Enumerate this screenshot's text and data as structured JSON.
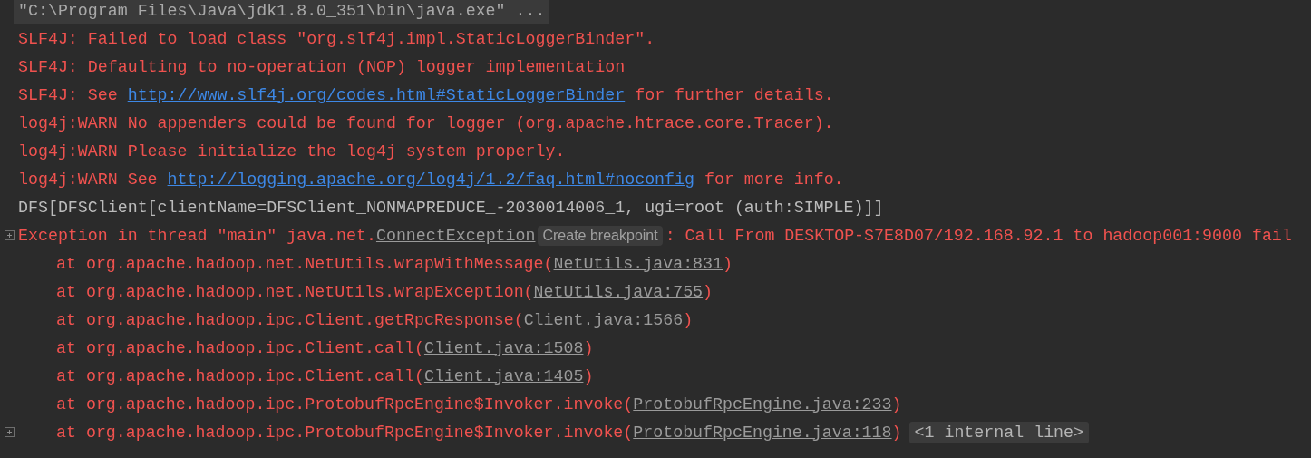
{
  "console": {
    "lines": [
      {
        "kind": "command",
        "fold": false,
        "segments": [
          {
            "kind": "text",
            "text": "\"C:\\Program Files\\Java\\jdk1.8.0_351\\bin\\java.exe\" ..."
          }
        ]
      },
      {
        "kind": "error",
        "fold": false,
        "segments": [
          {
            "kind": "text",
            "text": "SLF4J: Failed to load class \"org.slf4j.impl.StaticLoggerBinder\"."
          }
        ]
      },
      {
        "kind": "error",
        "fold": false,
        "segments": [
          {
            "kind": "text",
            "text": "SLF4J: Defaulting to no-operation (NOP) logger implementation"
          }
        ]
      },
      {
        "kind": "error",
        "fold": false,
        "segments": [
          {
            "kind": "text",
            "text": "SLF4J: See "
          },
          {
            "kind": "link",
            "text": "http://www.slf4j.org/codes.html#StaticLoggerBinder"
          },
          {
            "kind": "text",
            "text": " for further details."
          }
        ]
      },
      {
        "kind": "error",
        "fold": false,
        "segments": [
          {
            "kind": "text",
            "text": "log4j:WARN No appenders could be found for logger (org.apache.htrace.core.Tracer)."
          }
        ]
      },
      {
        "kind": "error",
        "fold": false,
        "segments": [
          {
            "kind": "text",
            "text": "log4j:WARN Please initialize the log4j system properly."
          }
        ]
      },
      {
        "kind": "error",
        "fold": false,
        "segments": [
          {
            "kind": "text",
            "text": "log4j:WARN See "
          },
          {
            "kind": "link",
            "text": "http://logging.apache.org/log4j/1.2/faq.html#noconfig"
          },
          {
            "kind": "text",
            "text": " for more info."
          }
        ]
      },
      {
        "kind": "normal",
        "fold": false,
        "segments": [
          {
            "kind": "text",
            "text": "DFS[DFSClient[clientName=DFSClient_NONMAPREDUCE_-2030014006_1, ugi=root (auth:SIMPLE)]]"
          }
        ]
      },
      {
        "kind": "error",
        "fold": true,
        "segments": [
          {
            "kind": "text",
            "text": "Exception in thread \"main\" java.net."
          },
          {
            "kind": "source",
            "text": "ConnectException"
          },
          {
            "kind": "hint",
            "text": "Create breakpoint"
          },
          {
            "kind": "text",
            "text": ": Call From DESKTOP-S7E8D07/192.168.92.1 to hadoop001:9000 fail"
          }
        ]
      },
      {
        "kind": "stack",
        "fold": false,
        "segments": [
          {
            "kind": "text",
            "text": "at org.apache.hadoop.net.NetUtils.wrapWithMessage("
          },
          {
            "kind": "source",
            "text": "NetUtils.java:831"
          },
          {
            "kind": "text",
            "text": ")"
          }
        ]
      },
      {
        "kind": "stack",
        "fold": false,
        "segments": [
          {
            "kind": "text",
            "text": "at org.apache.hadoop.net.NetUtils.wrapException("
          },
          {
            "kind": "source",
            "text": "NetUtils.java:755"
          },
          {
            "kind": "text",
            "text": ")"
          }
        ]
      },
      {
        "kind": "stack",
        "fold": false,
        "segments": [
          {
            "kind": "text",
            "text": "at org.apache.hadoop.ipc.Client.getRpcResponse("
          },
          {
            "kind": "source",
            "text": "Client.java:1566"
          },
          {
            "kind": "text",
            "text": ")"
          }
        ]
      },
      {
        "kind": "stack",
        "fold": false,
        "segments": [
          {
            "kind": "text",
            "text": "at org.apache.hadoop.ipc.Client.call("
          },
          {
            "kind": "source",
            "text": "Client.java:1508"
          },
          {
            "kind": "text",
            "text": ")"
          }
        ]
      },
      {
        "kind": "stack",
        "fold": false,
        "segments": [
          {
            "kind": "text",
            "text": "at org.apache.hadoop.ipc.Client.call("
          },
          {
            "kind": "source",
            "text": "Client.java:1405"
          },
          {
            "kind": "text",
            "text": ")"
          }
        ]
      },
      {
        "kind": "stack",
        "fold": false,
        "segments": [
          {
            "kind": "text",
            "text": "at org.apache.hadoop.ipc.ProtobufRpcEngine$Invoker.invoke("
          },
          {
            "kind": "source",
            "text": "ProtobufRpcEngine.java:233"
          },
          {
            "kind": "text",
            "text": ")"
          }
        ]
      },
      {
        "kind": "stack",
        "fold": true,
        "segments": [
          {
            "kind": "text",
            "text": "at org.apache.hadoop.ipc.ProtobufRpcEngine$Invoker.invoke("
          },
          {
            "kind": "source",
            "text": "ProtobufRpcEngine.java:118"
          },
          {
            "kind": "text",
            "text": ")"
          },
          {
            "kind": "fold-hint",
            "text": "<1 internal line>"
          }
        ]
      }
    ]
  }
}
